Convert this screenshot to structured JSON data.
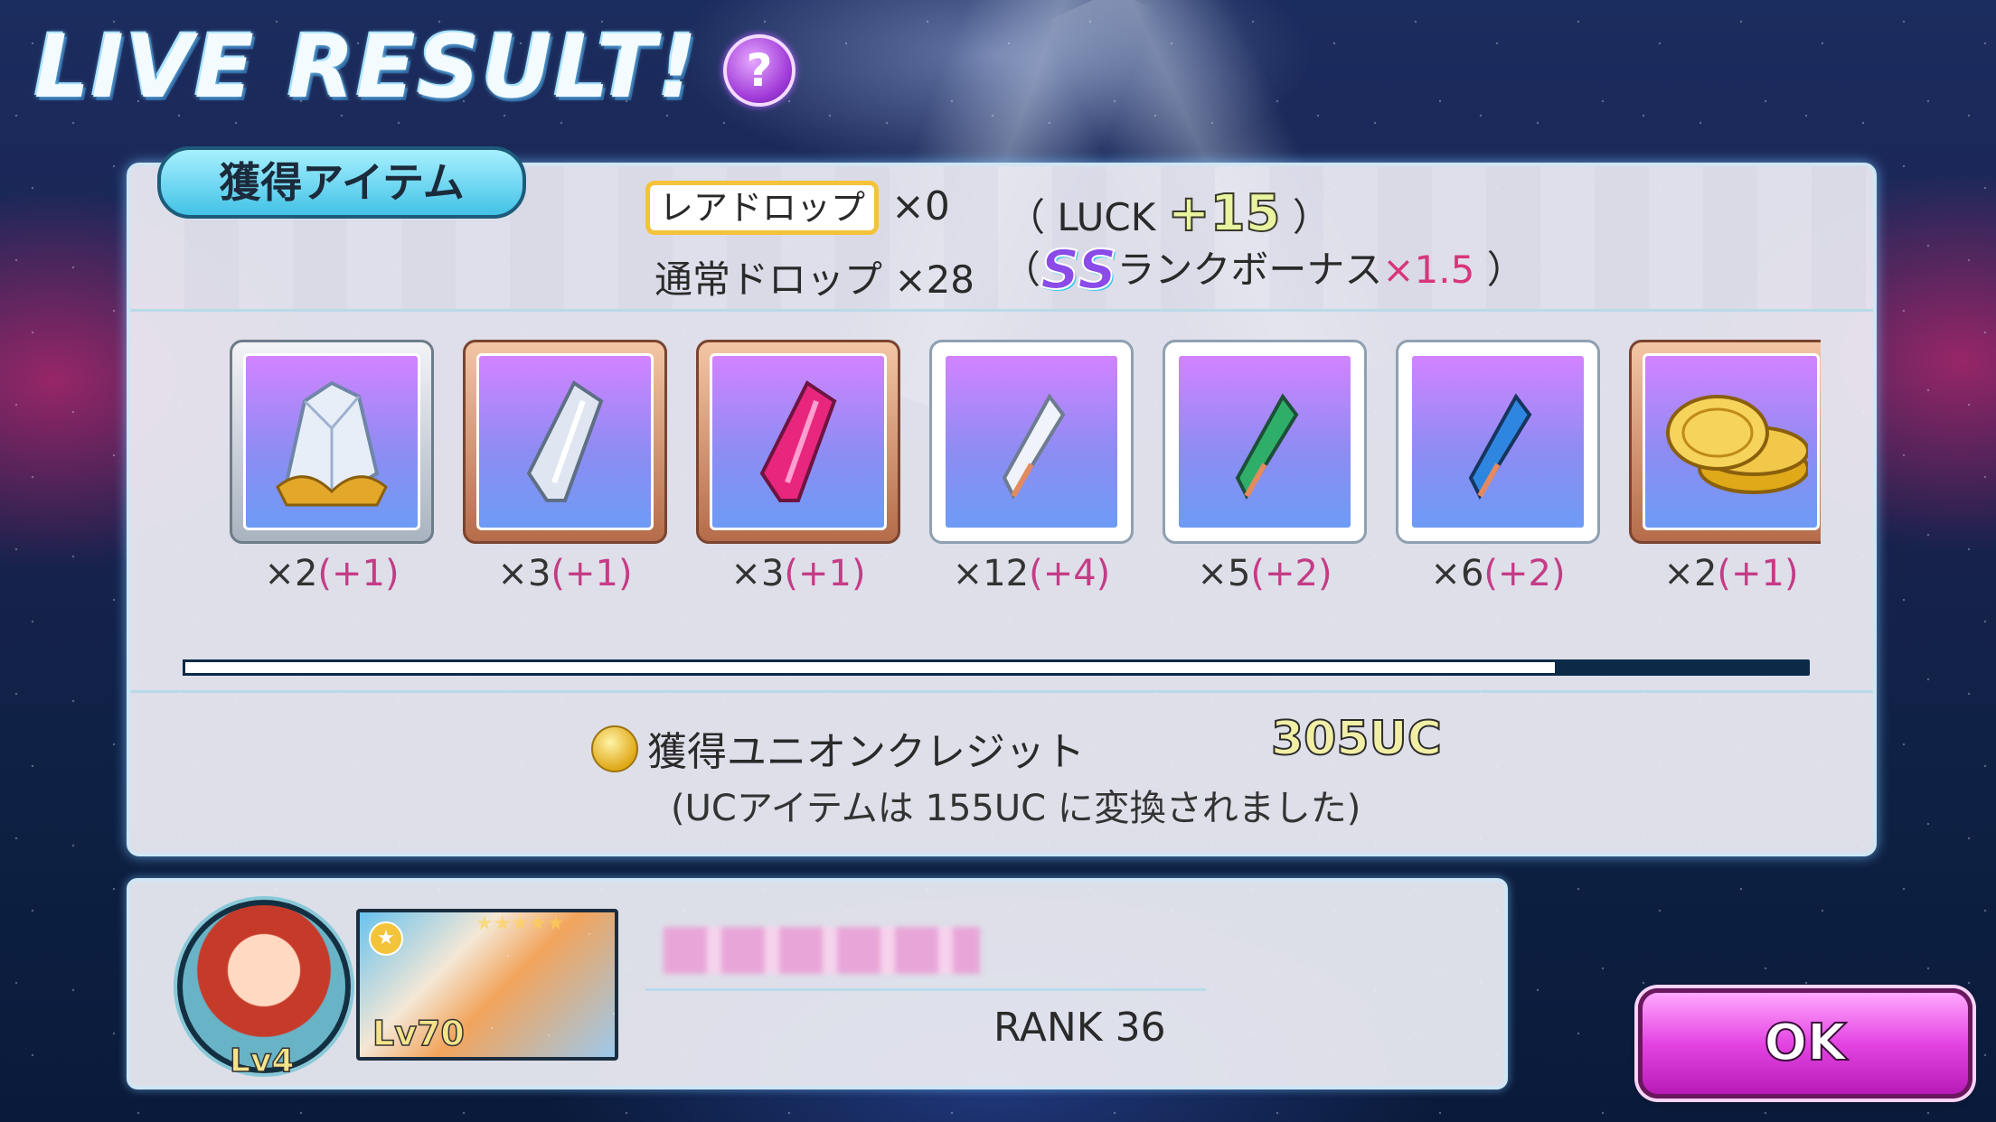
{
  "header": {
    "title": "LIVE RESULT!",
    "help_label": "?"
  },
  "items_panel": {
    "tab_label": "獲得アイテム",
    "rare_drop_label": "レアドロップ",
    "rare_drop_count": "×0",
    "luck_prefix": "（ LUCK",
    "luck_value": "+15",
    "luck_suffix": "）",
    "normal_drop_label": "通常ドロップ",
    "normal_drop_count": "×28",
    "bonus_open": "（",
    "rank_grade": "SS",
    "rank_bonus_label": "ランクボーナス",
    "rank_bonus_mult": "×1.5",
    "bonus_close": "）",
    "items": [
      {
        "icon": "white-crystal-cluster-icon",
        "frame": "silver",
        "count": "×2",
        "bonus": "(+1)"
      },
      {
        "icon": "silver-shard-icon",
        "frame": "bronze",
        "count": "×3",
        "bonus": "(+1)"
      },
      {
        "icon": "pink-shard-icon",
        "frame": "bronze",
        "count": "×3",
        "bonus": "(+1)"
      },
      {
        "icon": "white-crystal-icon",
        "frame": "white",
        "count": "×12",
        "bonus": "(+4)"
      },
      {
        "icon": "green-crystal-icon",
        "frame": "white",
        "count": "×5",
        "bonus": "(+2)"
      },
      {
        "icon": "blue-crystal-icon",
        "frame": "white",
        "count": "×6",
        "bonus": "(+2)"
      },
      {
        "icon": "gold-coins-icon",
        "frame": "bronze",
        "count": "×2",
        "bonus": "(+1)"
      }
    ],
    "scroll_progress": 0.845,
    "uc_label": "獲得ユニオンクレジット",
    "uc_value": "305UC",
    "uc_note": "(UCアイテムは 155UC に変換されました)"
  },
  "player": {
    "avatar_level": "Lv4",
    "card_level": "Lv70",
    "card_stars": "★★★★★",
    "rank": "RANK 36"
  },
  "ok_label": "OK",
  "colors": {
    "accent_pink": "#d8367a",
    "panel_border": "#cfe6f5",
    "ok_button": "#e445e2"
  }
}
